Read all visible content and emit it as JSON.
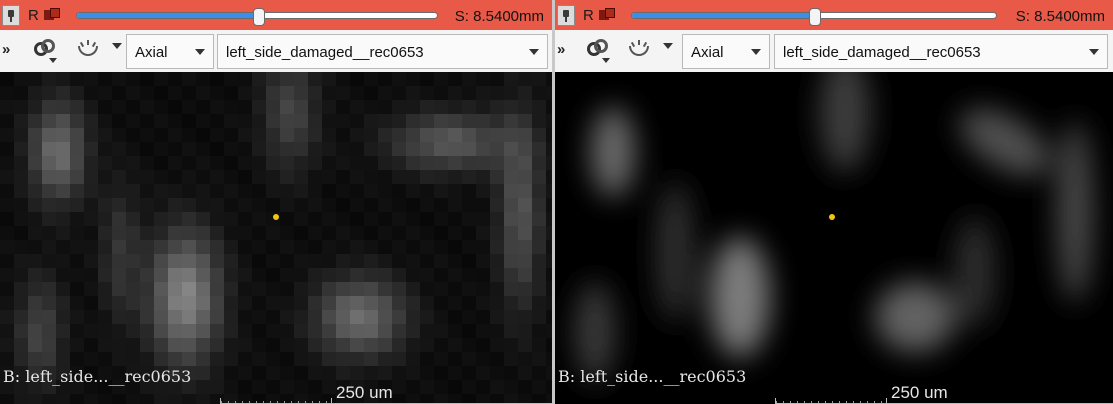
{
  "slice_bar": {
    "view_letter": "R",
    "slice_offset": "S: 8.5400mm",
    "slider_position": 0.5,
    "color": "#e85a47"
  },
  "toolbar": {
    "more_label": "»",
    "orientation": "Axial",
    "volume": "left_side_damaged__rec0653"
  },
  "overlay": {
    "bottom_left": "B: left_side...__rec0653",
    "scale_label": "250 um",
    "crosshair_color": "#f2c514"
  }
}
